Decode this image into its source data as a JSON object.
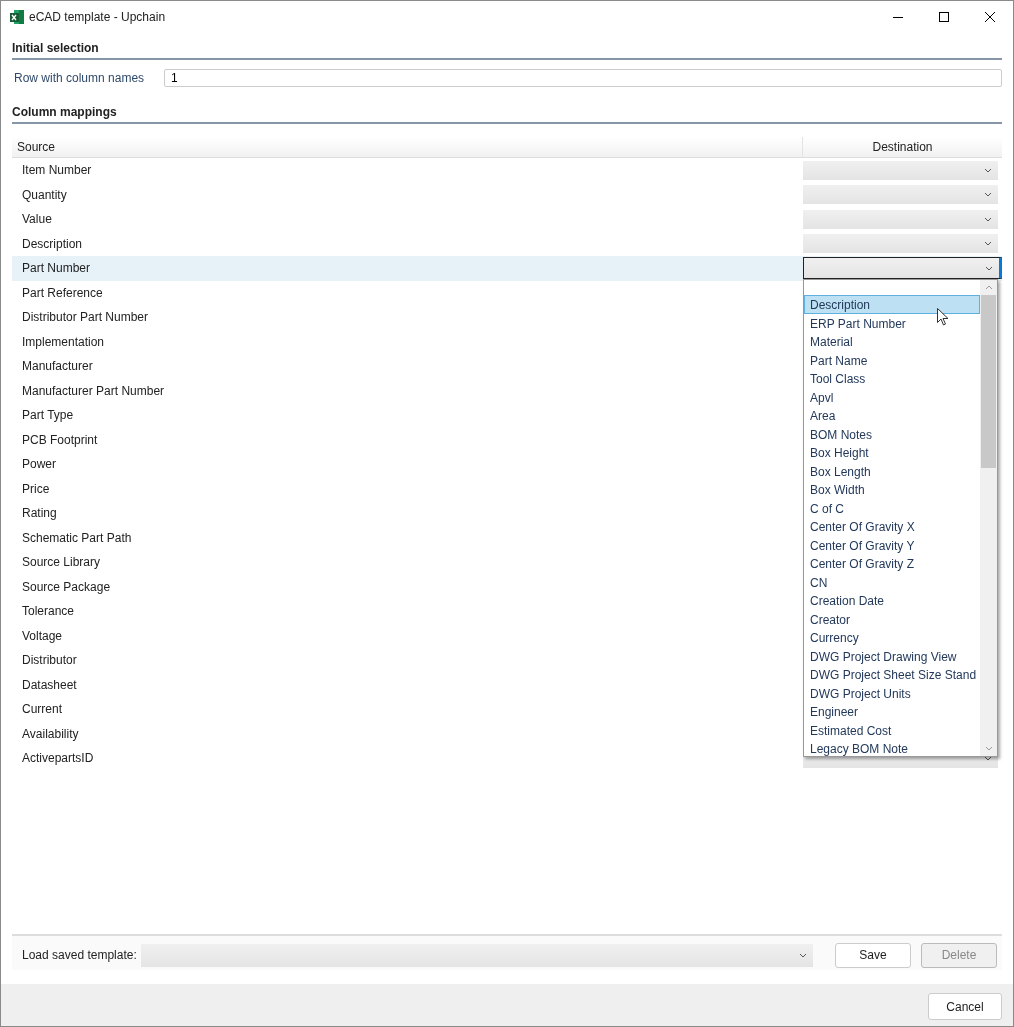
{
  "window": {
    "title": "eCAD template - Upchain"
  },
  "initial_selection": {
    "heading": "Initial selection",
    "row_label": "Row with column names",
    "row_value": "1"
  },
  "column_mappings": {
    "heading": "Column mappings",
    "columns": [
      "Source",
      "Destination"
    ],
    "rows": [
      {
        "source": "Item Number",
        "selected": false,
        "expanded": false
      },
      {
        "source": "Quantity",
        "selected": false,
        "expanded": false
      },
      {
        "source": "Value",
        "selected": false,
        "expanded": false
      },
      {
        "source": "Description",
        "selected": false,
        "expanded": false
      },
      {
        "source": "Part Number",
        "selected": true,
        "expanded": true
      },
      {
        "source": "Part Reference",
        "selected": false,
        "expanded": false
      },
      {
        "source": "Distributor Part Number",
        "selected": false,
        "expanded": false
      },
      {
        "source": "Implementation",
        "selected": false,
        "expanded": false
      },
      {
        "source": "Manufacturer",
        "selected": false,
        "expanded": false
      },
      {
        "source": "Manufacturer Part Number",
        "selected": false,
        "expanded": false
      },
      {
        "source": "Part Type",
        "selected": false,
        "expanded": false
      },
      {
        "source": "PCB Footprint",
        "selected": false,
        "expanded": false
      },
      {
        "source": "Power",
        "selected": false,
        "expanded": false
      },
      {
        "source": "Price",
        "selected": false,
        "expanded": false
      },
      {
        "source": "Rating",
        "selected": false,
        "expanded": false
      },
      {
        "source": "Schematic Part Path",
        "selected": false,
        "expanded": false
      },
      {
        "source": "Source Library",
        "selected": false,
        "expanded": false
      },
      {
        "source": "Source Package",
        "selected": false,
        "expanded": false
      },
      {
        "source": "Tolerance",
        "selected": false,
        "expanded": false
      },
      {
        "source": "Voltage",
        "selected": false,
        "expanded": false
      },
      {
        "source": "Distributor",
        "selected": false,
        "expanded": false
      },
      {
        "source": "Datasheet",
        "selected": false,
        "expanded": false
      },
      {
        "source": "Current",
        "selected": false,
        "expanded": false
      },
      {
        "source": "Availability",
        "selected": false,
        "expanded": false
      },
      {
        "source": "ActivepartsID",
        "selected": false,
        "expanded": false
      }
    ],
    "dropdown_options": [
      {
        "label": "Description",
        "selected": true
      },
      {
        "label": "ERP Part Number",
        "selected": false
      },
      {
        "label": "Material",
        "selected": false
      },
      {
        "label": "Part Name",
        "selected": false
      },
      {
        "label": "Tool Class",
        "selected": false
      },
      {
        "label": "Apvl",
        "selected": false
      },
      {
        "label": "Area",
        "selected": false
      },
      {
        "label": "BOM Notes",
        "selected": false
      },
      {
        "label": "Box Height",
        "selected": false
      },
      {
        "label": "Box Length",
        "selected": false
      },
      {
        "label": "Box Width",
        "selected": false
      },
      {
        "label": "C of C",
        "selected": false
      },
      {
        "label": "Center Of Gravity X",
        "selected": false
      },
      {
        "label": "Center Of Gravity Y",
        "selected": false
      },
      {
        "label": "Center Of Gravity Z",
        "selected": false
      },
      {
        "label": "CN",
        "selected": false
      },
      {
        "label": "Creation Date",
        "selected": false
      },
      {
        "label": "Creator",
        "selected": false
      },
      {
        "label": "Currency",
        "selected": false
      },
      {
        "label": "DWG Project Drawing View",
        "selected": false
      },
      {
        "label": "DWG Project Sheet Size Stand",
        "selected": false
      },
      {
        "label": "DWG Project Units",
        "selected": false
      },
      {
        "label": "Engineer",
        "selected": false
      },
      {
        "label": "Estimated Cost",
        "selected": false
      },
      {
        "label": "Legacy BOM Note",
        "selected": false
      }
    ]
  },
  "footer": {
    "label": "Load saved template:",
    "buttons": [
      {
        "label": "Save",
        "disabled": false
      },
      {
        "label": "Delete",
        "disabled": true
      }
    ]
  },
  "dialog_buttons": [
    {
      "label": "Cancel"
    }
  ]
}
